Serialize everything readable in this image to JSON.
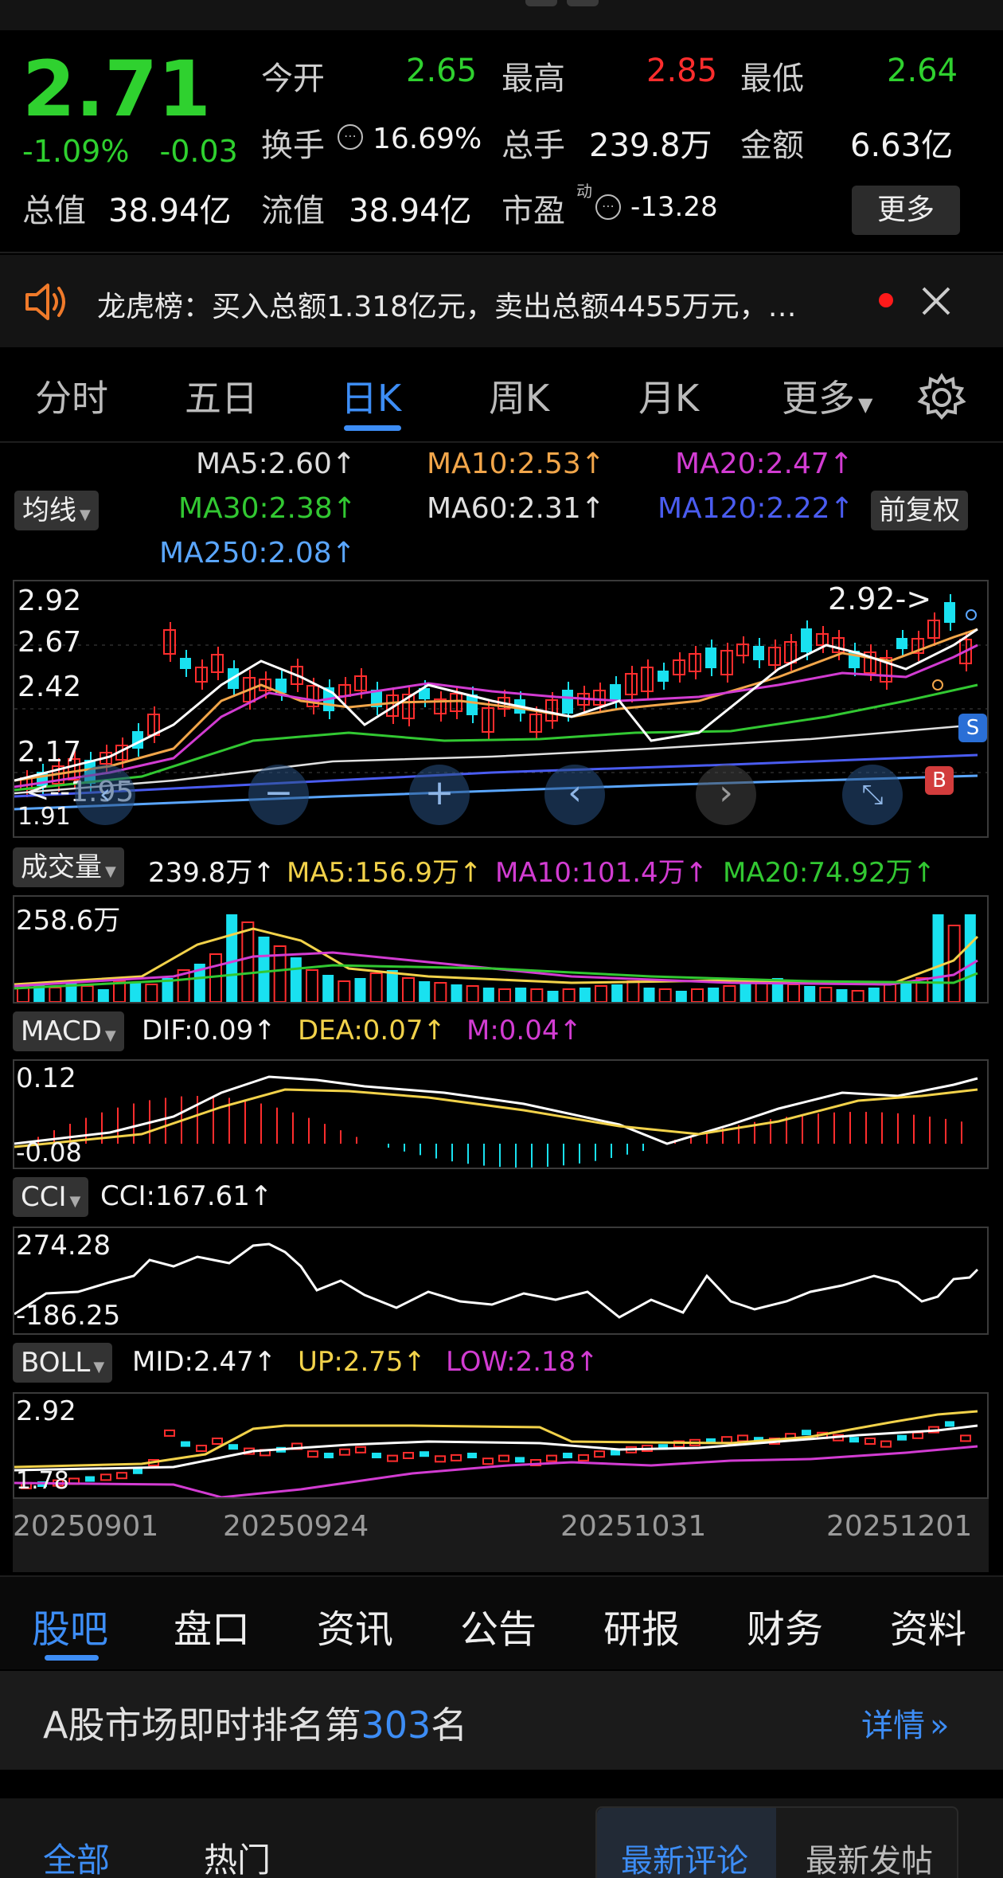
{
  "quote": {
    "price": "2.71",
    "change_pct": "-1.09%",
    "change_abs": "-0.03",
    "open_label": "今开",
    "open": "2.65",
    "high_label": "最高",
    "high": "2.85",
    "low_label": "最低",
    "low": "2.64",
    "turnover_label": "换手",
    "turnover": "16.69%",
    "volume_label": "总手",
    "volume": "239.8万",
    "amount_label": "金额",
    "amount": "6.63亿",
    "mktcap_label": "总值",
    "mktcap": "38.94亿",
    "float_label": "流值",
    "float": "38.94亿",
    "pe_label": "市盈",
    "pe_sup": "动",
    "pe": "-13.28",
    "more_button": "更多"
  },
  "news": {
    "text": "龙虎榜：买入总额1.318亿元，卖出总额4455万元，…"
  },
  "tabs": [
    "分时",
    "五日",
    "日K",
    "周K",
    "月K",
    "更多"
  ],
  "active_tab": "日K",
  "ma_legend": {
    "selector": "均线",
    "fuquan": "前复权",
    "items": [
      {
        "label": "MA5:2.60↑",
        "color": "#f2f2f2"
      },
      {
        "label": "MA10:2.53↑",
        "color": "#f2a64a"
      },
      {
        "label": "MA20:2.47↑",
        "color": "#d23cd2"
      },
      {
        "label": "MA30:2.38↑",
        "color": "#32c832"
      },
      {
        "label": "MA60:2.31↑",
        "color": "#e0e0e0"
      },
      {
        "label": "MA120:2.22↑",
        "color": "#4a5cf0"
      },
      {
        "label": "MA250:2.08↑",
        "color": "#5aa6ff"
      }
    ]
  },
  "kline": {
    "y_labels": [
      "2.92",
      "2.67",
      "2.42",
      "2.17",
      "1.91"
    ],
    "max_marker": "2.92->",
    "min_marker": "<--1.95",
    "sell_marker": "S",
    "buy_marker": "B",
    "zoom_icons": [
      "minus-icon",
      "plus-icon",
      "left-icon",
      "right-icon",
      "fullscreen-icon"
    ]
  },
  "volume": {
    "selector": "成交量",
    "current": "239.8万↑",
    "ma5": "MA5:156.9万↑",
    "ma10": "MA10:101.4万↑",
    "ma20": "MA20:74.92万↑",
    "y_label": "258.6万"
  },
  "macd": {
    "selector": "MACD",
    "dif": "DIF:0.09↑",
    "dea": "DEA:0.07↑",
    "m": "M:0.04↑",
    "y_top": "0.12",
    "y_bottom": "-0.08"
  },
  "cci": {
    "selector": "CCI",
    "value": "CCI:167.61↑",
    "y_top": "274.28",
    "y_bottom": "-186.25"
  },
  "boll": {
    "selector": "BOLL",
    "mid": "MID:2.47↑",
    "up": "UP:2.75↑",
    "low": "LOW:2.18↑",
    "y_top": "2.92",
    "y_bottom": "1.78"
  },
  "dates": [
    "20250901",
    "20250924",
    "20251031",
    "20251201"
  ],
  "bottom_tabs": [
    "股吧",
    "盘口",
    "资讯",
    "公告",
    "研报",
    "财务",
    "资料"
  ],
  "rank": {
    "prefix": "A股市场即时排名第",
    "number": "303",
    "suffix": "名",
    "detail": "详情"
  },
  "comments": {
    "all": "全部",
    "hot": "热门",
    "latest_comment": "最新评论",
    "latest_post": "最新发帖"
  },
  "colors": {
    "up": "#ff2d2d",
    "down": "#2fd12f",
    "accent": "#3d8df5",
    "cyan": "#19e1f0"
  }
}
